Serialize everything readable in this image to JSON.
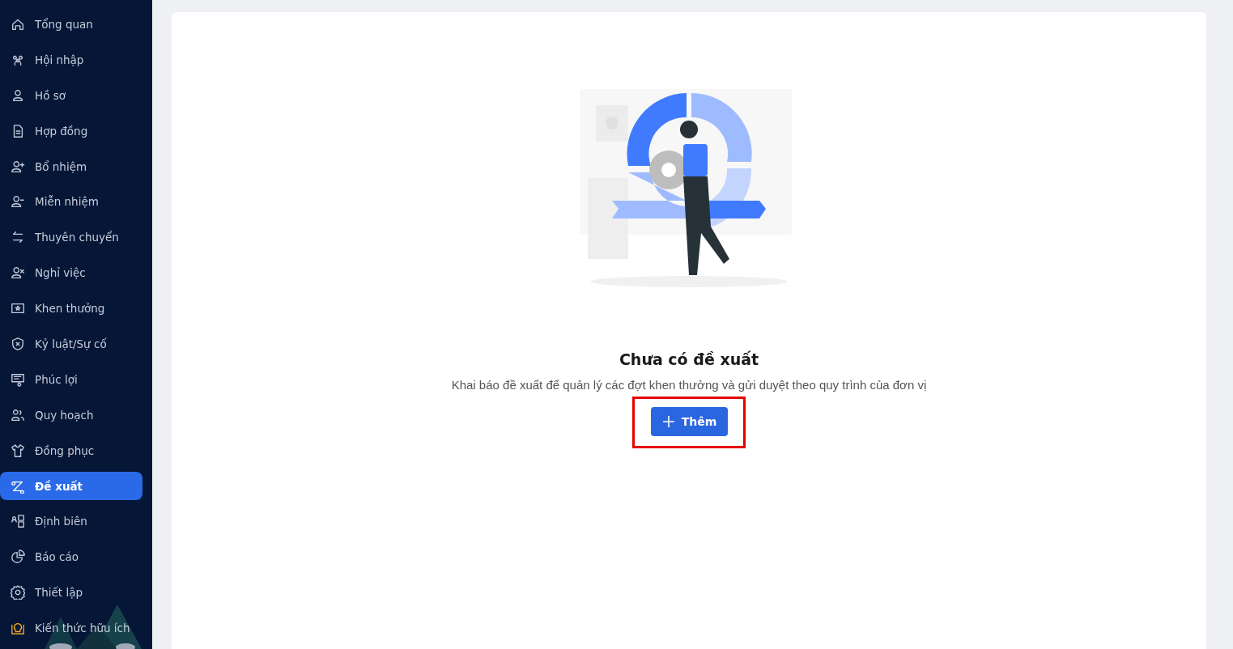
{
  "sidebar": {
    "items": [
      {
        "label": "Tổng quan",
        "selected": false,
        "kind": "nav"
      },
      {
        "label": "Hội nhập",
        "selected": false,
        "kind": "nav"
      },
      {
        "label": "Hồ sơ",
        "selected": false,
        "kind": "nav"
      },
      {
        "label": "Hợp đồng",
        "selected": false,
        "kind": "nav"
      },
      {
        "label": "Bổ nhiệm",
        "selected": false,
        "kind": "nav"
      },
      {
        "label": "Miễn nhiệm",
        "selected": false,
        "kind": "nav"
      },
      {
        "label": "Thuyên chuyển",
        "selected": false,
        "kind": "nav"
      },
      {
        "label": "Nghỉ việc",
        "selected": false,
        "kind": "nav"
      },
      {
        "label": "Khen thưởng",
        "selected": false,
        "kind": "nav"
      },
      {
        "label": "Kỷ luật/Sự cố",
        "selected": false,
        "kind": "nav"
      },
      {
        "label": "Phúc lợi",
        "selected": false,
        "kind": "nav"
      },
      {
        "label": "Quy hoạch",
        "selected": false,
        "kind": "nav"
      },
      {
        "label": "Đồng phục",
        "selected": false,
        "kind": "nav"
      },
      {
        "label": "Đề xuất",
        "selected": true,
        "kind": "nav"
      },
      {
        "label": "Định biên",
        "selected": false,
        "kind": "nav"
      },
      {
        "label": "Báo cáo",
        "selected": false,
        "kind": "nav"
      },
      {
        "label": "Thiết lập",
        "selected": false,
        "kind": "nav"
      },
      {
        "label": "Kiến thức hữu ích",
        "selected": false,
        "kind": "tip"
      }
    ]
  },
  "empty_state": {
    "title": "Chưa có đề xuất",
    "description": "Khai báo đề xuất để quản lý các đợt khen thưởng và gửi duyệt theo quy trình của đơn vị",
    "button": {
      "label": "Thêm",
      "highlighted": true
    }
  }
}
